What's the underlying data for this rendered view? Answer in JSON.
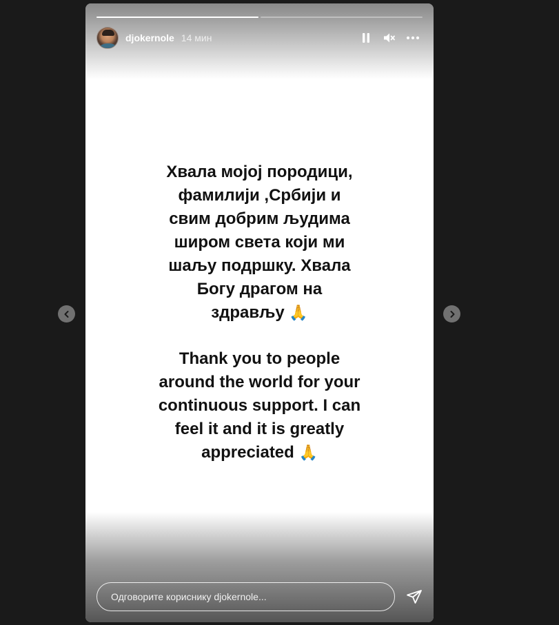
{
  "story": {
    "progress": [
      1.0,
      0.0
    ],
    "author": {
      "username": "djokernole",
      "time": "14 мин"
    },
    "controls": {
      "pause_icon": "pause-icon",
      "mute_icon": "volume-muted-icon",
      "more_icon": "more-options-icon"
    },
    "text_serbian": [
      "Хвала мојој породици,",
      "фамилији ,Србији и",
      "свим добрим људима",
      "широм света који ми",
      "шаљу подршку. Хвала",
      "Богу драгом на",
      "здрављу"
    ],
    "text_english": [
      "Thank you to people",
      "around the world for your",
      "continuous support. I can",
      "feel it and it is greatly",
      "appreciated"
    ],
    "emoji": "🙏",
    "reply": {
      "placeholder": "Одговорите кориснику djokernole..."
    },
    "send_icon": "send-icon"
  },
  "navigation": {
    "prev_icon": "chevron-left-icon",
    "next_icon": "chevron-right-icon"
  },
  "colors": {
    "page_background": "#1a1a1a",
    "story_background": "#ffffff",
    "text": "#111111",
    "ui_foreground": "#ffffff"
  }
}
